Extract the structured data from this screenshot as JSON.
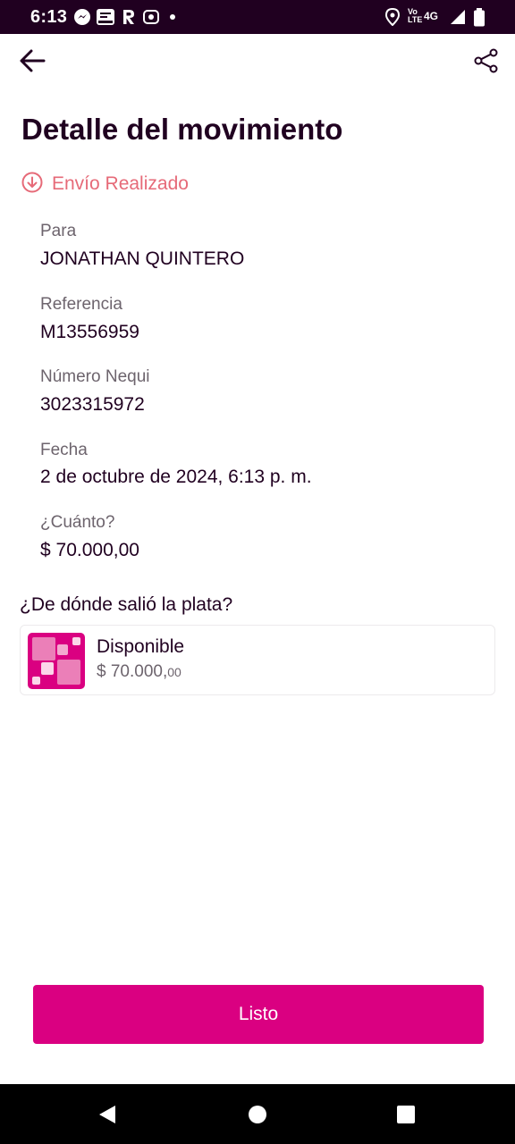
{
  "status_bar": {
    "time": "6:13",
    "lte_label": "Vo\nLTE",
    "network_label": "4G",
    "icons": [
      "messenger-icon",
      "app-notification-icon",
      "r-app-icon",
      "record-icon",
      "more-dot-icon",
      "location-icon",
      "signal-icon",
      "battery-icon"
    ]
  },
  "header": {
    "back_icon": "arrow-left-icon",
    "share_icon": "share-icon",
    "title": "Detalle del movimiento"
  },
  "status": {
    "icon": "arrow-down-circle-icon",
    "text": "Envío Realizado",
    "color": "#e66a78"
  },
  "details": {
    "to_label": "Para",
    "to_value": "JONATHAN QUINTERO",
    "reference_label": "Referencia",
    "reference_value": "M13556959",
    "nequi_label": "Número Nequi",
    "nequi_value": "3023315972",
    "date_label": "Fecha",
    "date_value": "2 de octubre de 2024, 6:13 p. m.",
    "amount_label": "¿Cuánto?",
    "amount_value": "$ 70.000,00"
  },
  "source": {
    "heading": "¿De dónde salió la plata?",
    "name": "Disponible",
    "amount_main": "$ 70.000,",
    "amount_cents": "00"
  },
  "actions": {
    "done_label": "Listo"
  },
  "navigation": {
    "back": "nav-back-icon",
    "home": "nav-home-icon",
    "recents": "nav-recents-icon"
  },
  "colors": {
    "brand": "#da0081",
    "dark": "#200020",
    "status": "#e66a78",
    "muted": "#6d646d"
  }
}
